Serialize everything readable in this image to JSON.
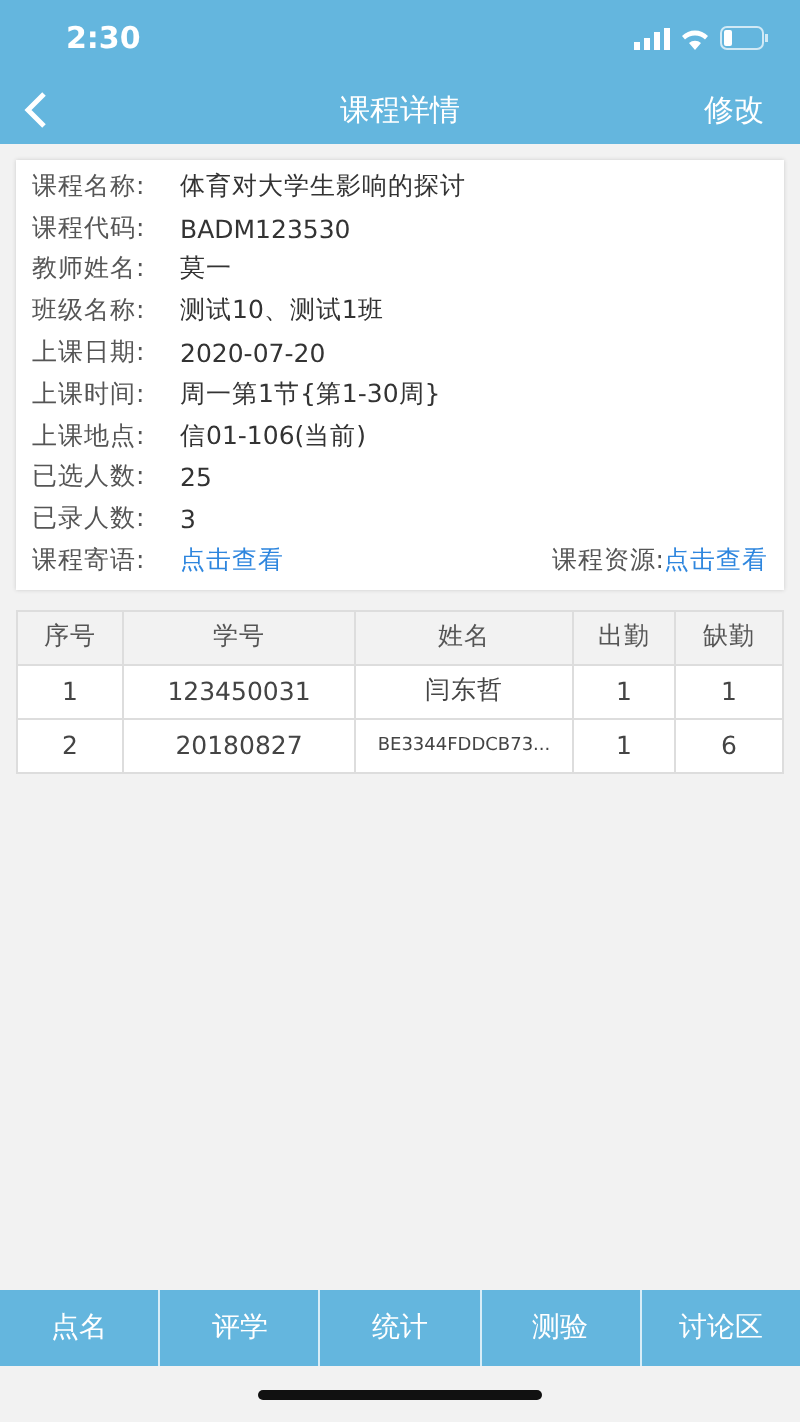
{
  "status_bar": {
    "time": "2:30"
  },
  "nav": {
    "title": "课程详情",
    "action": "修改"
  },
  "details": [
    {
      "label": "课程名称:",
      "value": "体育对大学生影响的探讨"
    },
    {
      "label": "课程代码:",
      "value": " BADM123530"
    },
    {
      "label": "教师姓名:",
      "value": "莫一"
    },
    {
      "label": "班级名称:",
      "value": "测试10、测试1班"
    },
    {
      "label": "上课日期:",
      "value": "2020-07-20"
    },
    {
      "label": "上课时间:",
      "value": "周一第1节{第1-30周}"
    },
    {
      "label": "上课地点:",
      "value": "信01-106(当前)"
    },
    {
      "label": "已选人数:",
      "value": "25"
    },
    {
      "label": "已录人数:",
      "value": "3"
    }
  ],
  "links": {
    "message_label": "课程寄语:",
    "message_link": "点击查看",
    "resource_label": "课程资源:",
    "resource_link": "点击查看"
  },
  "table": {
    "columns": [
      "序号",
      "学号",
      "姓名",
      "出勤",
      "缺勤"
    ],
    "rows": [
      [
        "1",
        "123450031",
        "闫东哲",
        "1",
        "1"
      ],
      [
        "2",
        "20180827",
        "BE3344FDDCB73...",
        "1",
        "6"
      ]
    ]
  },
  "bottom_tabs": [
    "点名",
    "评学",
    "统计",
    "测验",
    "讨论区"
  ]
}
